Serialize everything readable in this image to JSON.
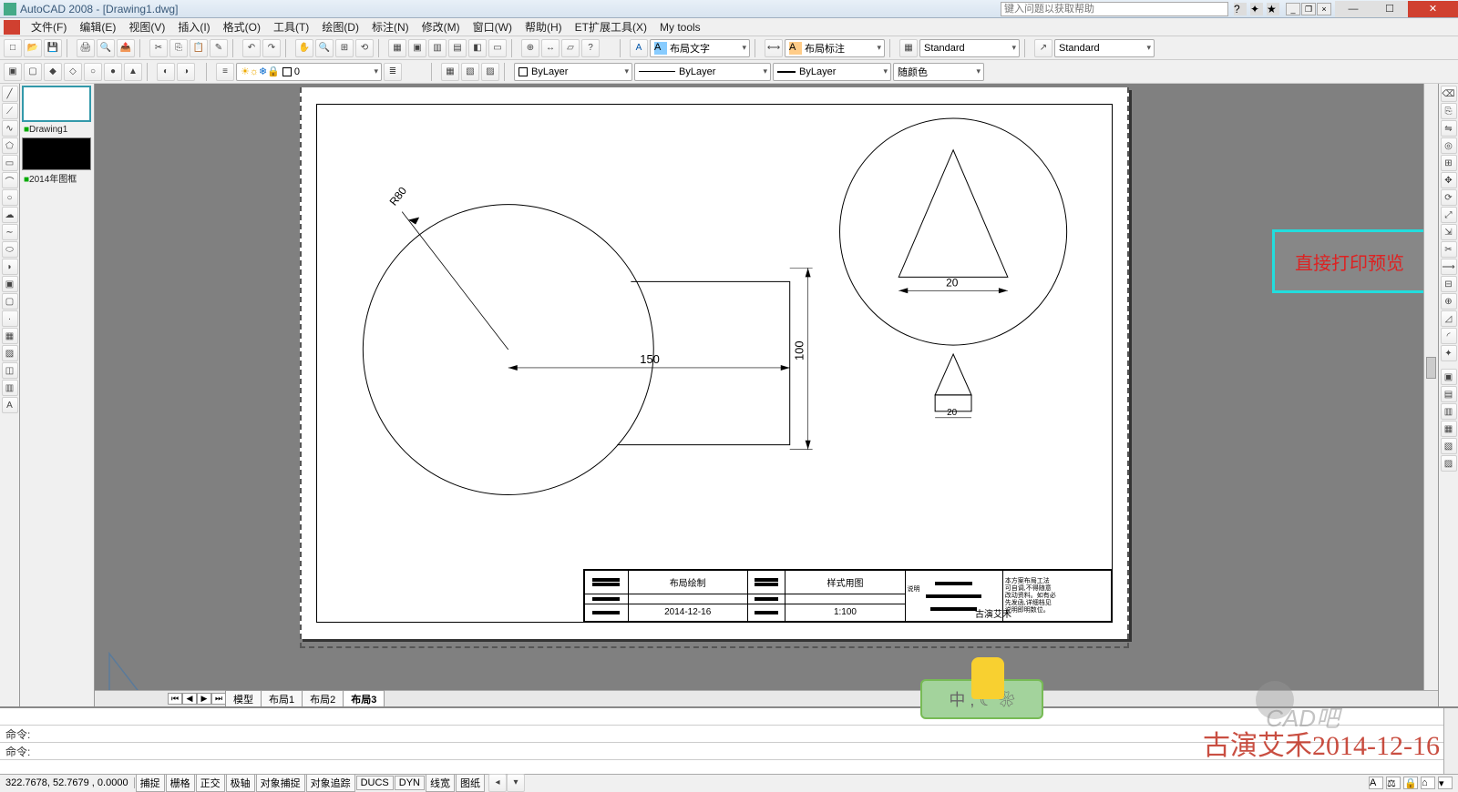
{
  "title": "AutoCAD 2008 - [Drawing1.dwg]",
  "help_placeholder": "键入问题以获取帮助",
  "menu": [
    "文件(F)",
    "编辑(E)",
    "视图(V)",
    "插入(I)",
    "格式(O)",
    "工具(T)",
    "绘图(D)",
    "标注(N)",
    "修改(M)",
    "窗口(W)",
    "帮助(H)",
    "ET扩展工具(X)",
    "My tools"
  ],
  "toolbar2": {
    "anno_text": "布局文字",
    "anno_dim": "布局标注",
    "std1": "Standard",
    "std2": "Standard"
  },
  "toolbar3": {
    "layer": "0",
    "linelayer": "ByLayer",
    "ltype": "ByLayer",
    "lweight": "ByLayer",
    "color": "随颜色"
  },
  "docpanel": {
    "doc1": "Drawing1",
    "doc2": "2014年图框"
  },
  "callout": "直接打印预览",
  "tabs": [
    "模型",
    "布局1",
    "布局2",
    "布局3"
  ],
  "active_tab": 3,
  "cmd_prompt": "命令:",
  "status": {
    "coords": "322.7678, 52.7679 , 0.0000",
    "toggles": [
      "捕捉",
      "栅格",
      "正交",
      "极轴",
      "对象捕捉",
      "对象追踪",
      "DUCS",
      "DYN",
      "线宽",
      "图纸"
    ]
  },
  "drawing": {
    "dim150": "150",
    "dim100": "100",
    "r80": "R80",
    "dim20a": "20",
    "dim20b": "20"
  },
  "titleblock": {
    "c1": "布局绘制",
    "c2": "样式用图",
    "date": "2014-12-16",
    "scale": "1:100",
    "author": "古演艾禾"
  },
  "overlay": {
    "ime": "中 , ☾ ❀",
    "stamp": "古演艾禾2014-12-16",
    "cadba": "CAD吧"
  }
}
